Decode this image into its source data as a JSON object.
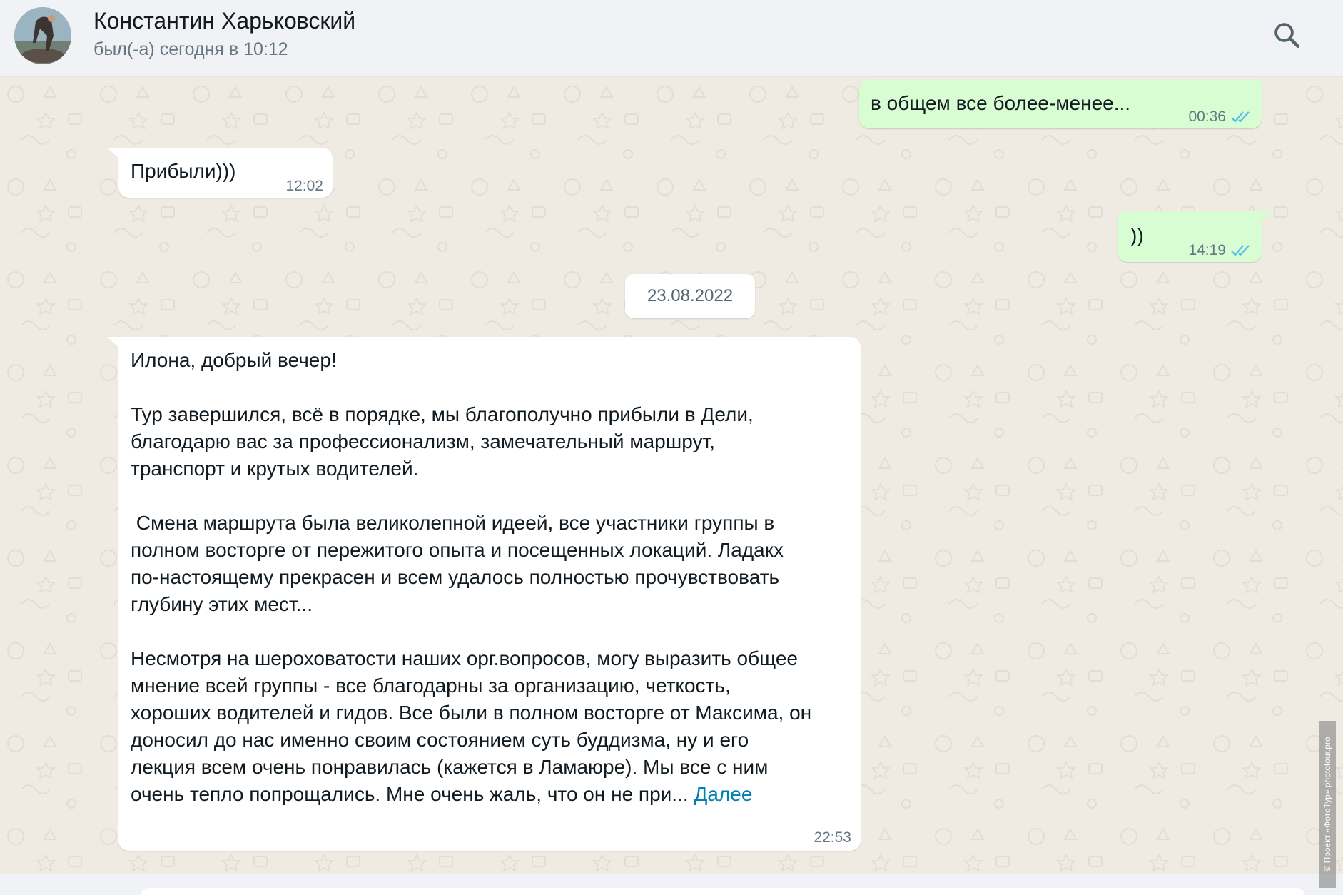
{
  "header": {
    "contact_name": "Константин Харьковский",
    "status": "был(-а) сегодня в 10:12",
    "avatar_icon": "avatar-photo",
    "search_icon": "search-icon"
  },
  "messages": [
    {
      "direction": "out",
      "text": "в общем все более-менее...",
      "time": "00:36",
      "status": "read"
    },
    {
      "direction": "in",
      "text": "Прибыли)))",
      "time": "12:02"
    },
    {
      "direction": "out",
      "text": "))",
      "time": "14:19",
      "status": "read"
    },
    {
      "direction": "in",
      "text": "Илона, добрый вечер!\n\nТур завершился, всё в порядке, мы благополучно прибыли в Дели,\nблагодарю вас за профессионализм, замечательный маршрут,\nтранспорт и крутых водителей.\n\n Смена маршрута была великолепной идеей, все участники группы в\nполном восторге от пережитого опыта и посещенных локаций. Ладакх\nпо-настоящему прекрасен и всем удалось полностью прочувствовать\nглубину этих мест...\n\nНесмотря на шероховатости наших орг.вопросов, могу выразить общее\nмнение всей группы - все благодарны за организацию, четкость,\nхороших водителей и гидов. Все были в полном восторге от Максима, он\nдоносил до нас именно своим состоянием суть буддизма, ну и его\nлекция всем очень понравилась (кажется в Ламаюре). Мы все с ним\nочень тепло попрощались. Мне очень жаль, что он не при... ",
      "more": "Далее",
      "time": "22:53"
    }
  ],
  "date_separator": "23.08.2022",
  "watermark": "© Проект «ФотоТур» phototour.pro",
  "colors": {
    "chat_bg": "#efeae2",
    "incoming_bubble": "#ffffff",
    "outgoing_bubble": "#d9fdd3",
    "read_ticks": "#53bdeb",
    "link": "#027eb5",
    "header_bg": "#f0f2f5"
  }
}
